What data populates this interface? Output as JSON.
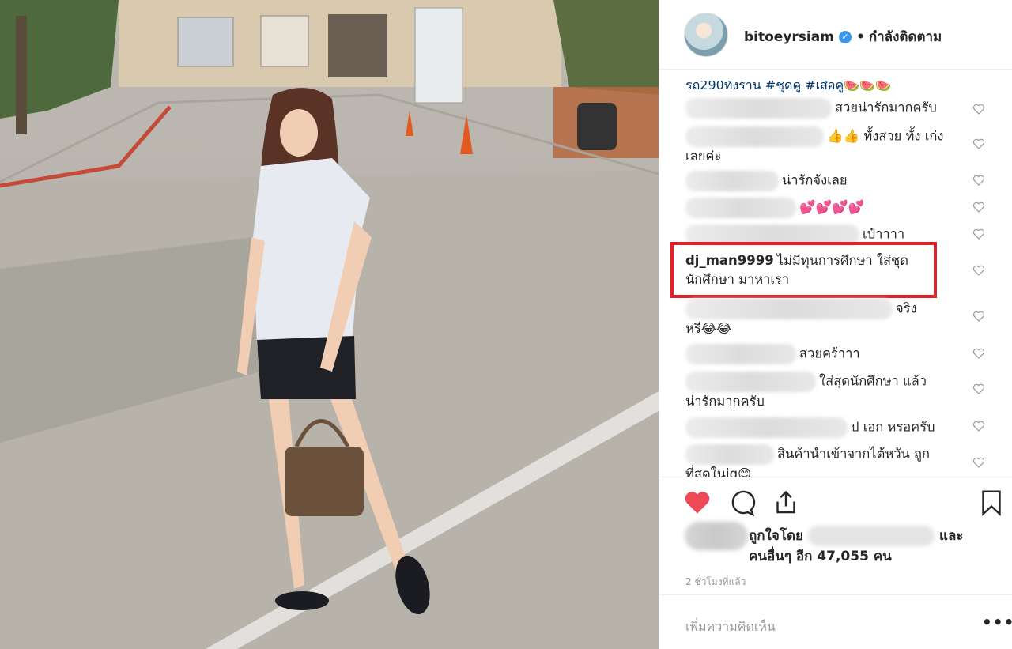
{
  "post": {
    "username": "bitoeyrsiam",
    "separator": "•",
    "follow_status": "กำลังติดตาม",
    "caption_tail": "รถ290ทั้งร้าน #ชุดคู่ #เสื้อคู่🍉🍉🍉"
  },
  "comments": [
    {
      "user": "",
      "text": "สวยน่ารักมากครับ"
    },
    {
      "user": "",
      "text": "👍👍 ทั้งสวย ทั้ง เก่งเลยค่ะ"
    },
    {
      "user": "",
      "text": "น่ารักจังเลย"
    },
    {
      "user": "",
      "text": "💕💕💕💕"
    },
    {
      "user": "",
      "text": "เป๋าาาา"
    },
    {
      "user": "dj_man9999",
      "text": "ไม่มีทุนการศึกษา ใส่ชุด นักศึกษา มาหาเรา"
    },
    {
      "user": "",
      "text": "จริง หรี😂😂"
    },
    {
      "user": "",
      "text": "สวยคร้าาา"
    },
    {
      "user": "",
      "text": "ใส่สุดนักศึกษา แล้ว น่ารักมากครับ"
    },
    {
      "user": "",
      "text": "ป เอก หรอครับ"
    },
    {
      "user": "",
      "text": "สินค้านำเข้าจากไต้หวัน ถูก ที่สุดในig😊"
    }
  ],
  "likes": {
    "liked_by_prefix": "ถูกใจโดย",
    "and": "และ",
    "others": "คนอื่นๆ อีก 47,055 คน"
  },
  "timestamp": "2 ชั่วโมงที่แล้ว",
  "add_comment_placeholder": "เพิ่มความคิดเห็น",
  "more_label": "•••",
  "colors": {
    "like_red": "#ed4956",
    "verified_blue": "#3897f0",
    "highlight_red": "#e2202c",
    "link_navy": "#003569"
  },
  "icons": [
    "heart-filled-icon",
    "comment-icon",
    "share-icon",
    "bookmark-icon",
    "heart-outline-icon",
    "verified-badge-icon"
  ]
}
